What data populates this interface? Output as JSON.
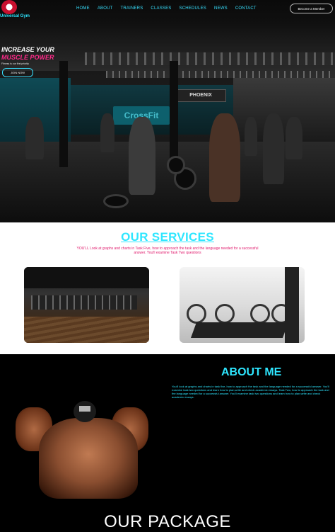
{
  "brand": {
    "name": "Universal Gym"
  },
  "nav": {
    "items": [
      "HOME",
      "ABOUT",
      "TRAINERS",
      "CLASSES",
      "SCHEDULES",
      "NEWS",
      "CONTACT"
    ],
    "cta": "Become a Member"
  },
  "hero": {
    "line1": "INCREASE YOUR",
    "line2": "MUSCLE POWER",
    "tagline": "Fitness is our first priority",
    "button": "JOIN NOW",
    "sign_text": "PHOENIX",
    "logo_text": "CrossFit"
  },
  "services": {
    "title": "OUR SERVICES",
    "text": "YOU'LL Look at graphs and charts in Task Five, how to approach the task and the language needed for a successful answer. You'll examine Task Two questions"
  },
  "about": {
    "title": "ABOUT ME",
    "text": "You'll look at graphs and charts in task five, how to approach the task and the language needed for a successful answer. You'll examine task two questions and learn how to plan,write and check academic essays. Task Two, how to approach the task and the language needed for a successful answer. You'll examine task two questions and learn how to plan,write and check academic essays."
  },
  "package": {
    "title": "OUR PACKAGE"
  },
  "colors": {
    "accent": "#2ee6ff",
    "pink": "#ff2a8a",
    "text_pink": "#e0186b"
  }
}
